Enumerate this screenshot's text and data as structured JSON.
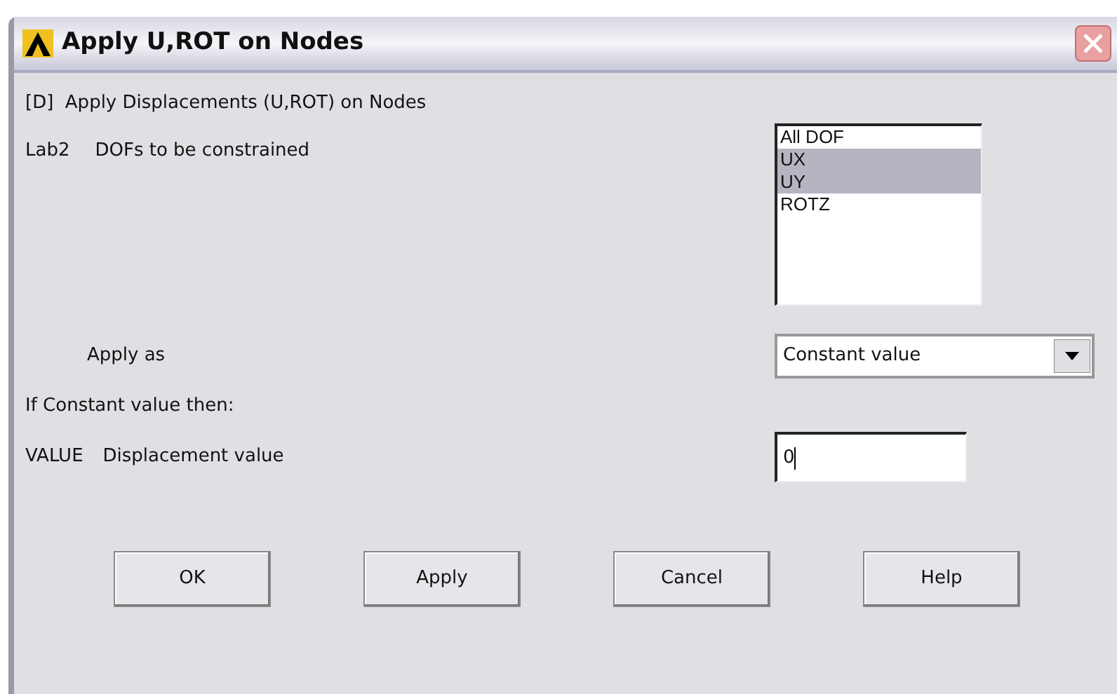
{
  "window": {
    "title": "Apply U,ROT on Nodes"
  },
  "heading": "[D]  Apply Displacements (U,ROT) on Nodes",
  "dof_field": {
    "code": "Lab2",
    "label": "DOFs to be constrained",
    "options": [
      {
        "label": "All DOF",
        "selected": false
      },
      {
        "label": "UX",
        "selected": true
      },
      {
        "label": "UY",
        "selected": true
      },
      {
        "label": "ROTZ",
        "selected": false
      }
    ]
  },
  "apply_as": {
    "label": "Apply as",
    "value": "Constant value"
  },
  "note": "If Constant value then:",
  "value_field": {
    "code": "VALUE",
    "label": "Displacement value",
    "value": "0"
  },
  "buttons": [
    "OK",
    "Apply",
    "Cancel",
    "Help"
  ]
}
